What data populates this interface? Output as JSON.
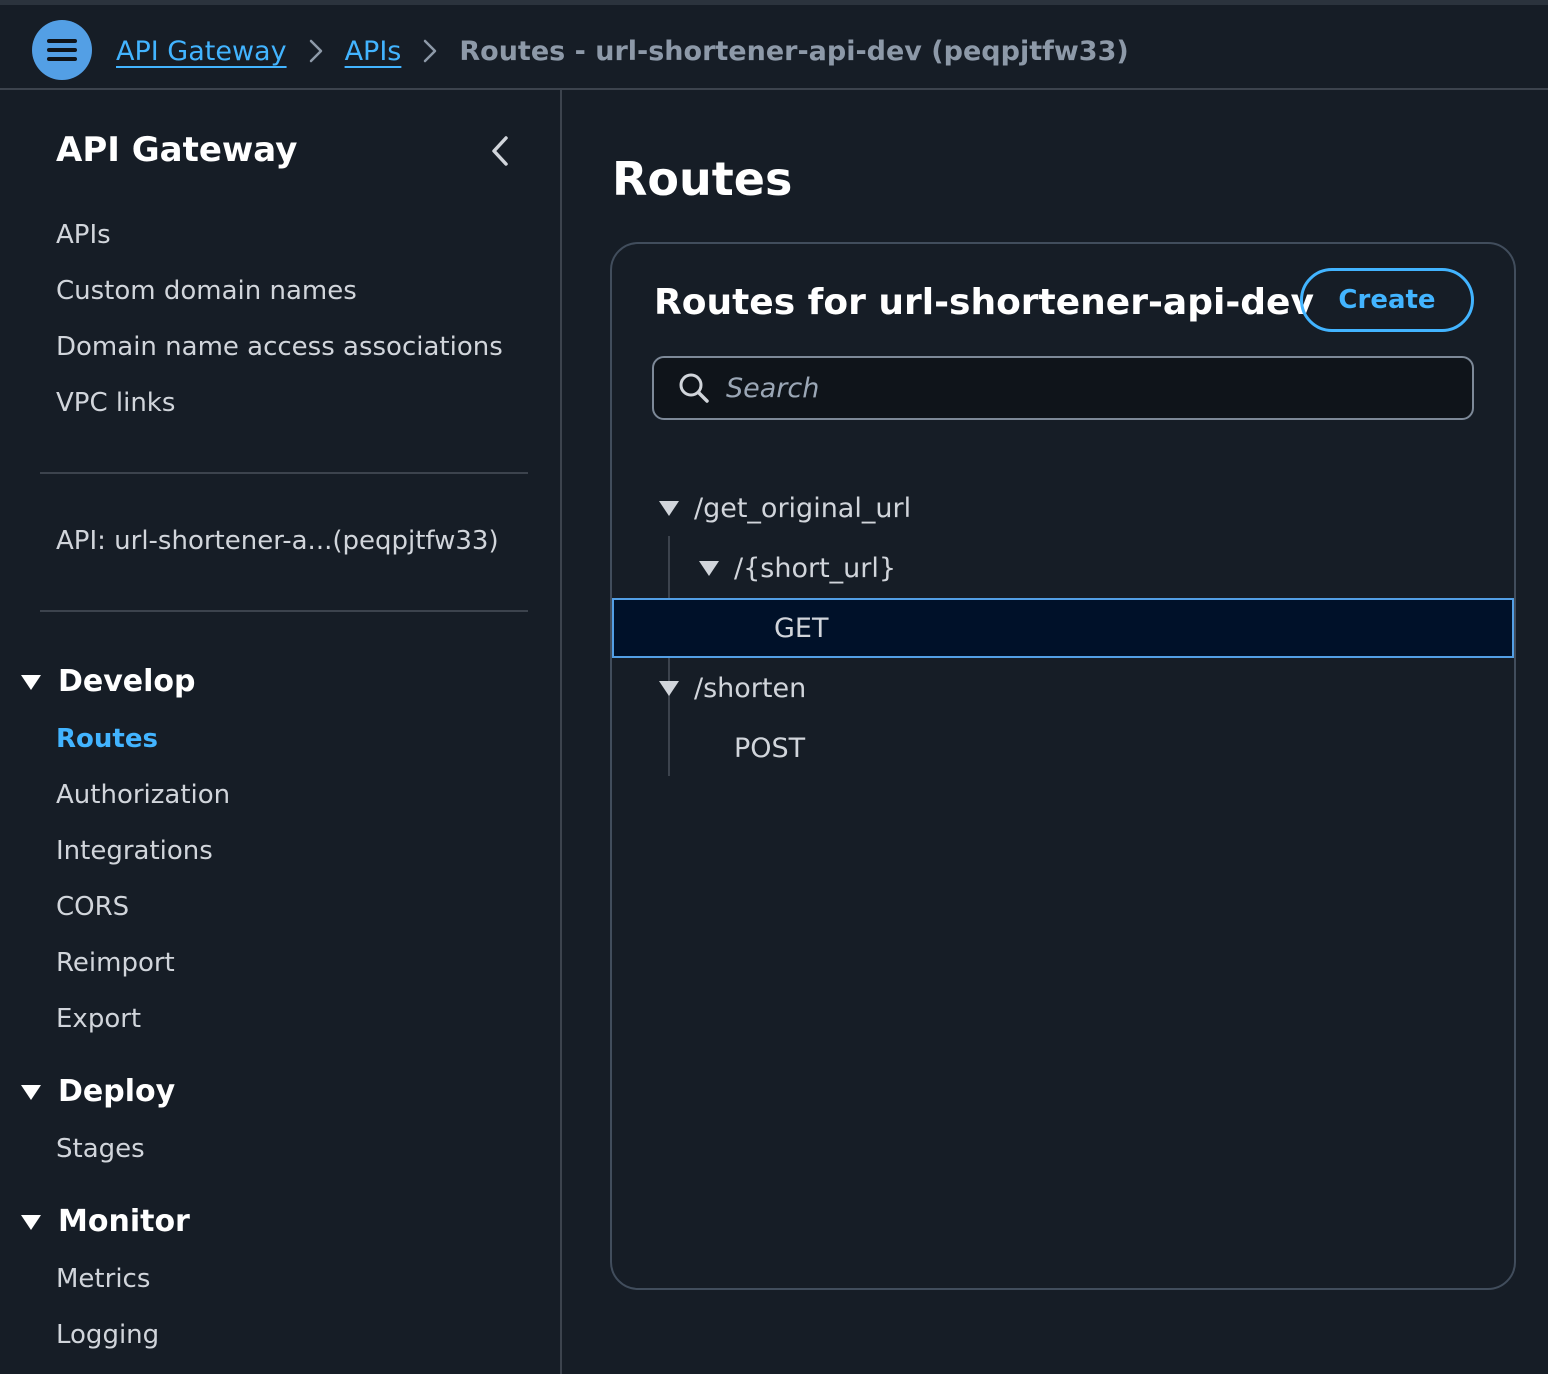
{
  "header": {
    "breadcrumb": {
      "api_gateway": "API Gateway",
      "apis": "APIs",
      "current": "Routes - url-shortener-api-dev (peqpjtfw33)"
    }
  },
  "sidebar": {
    "title": "API Gateway",
    "top_items": [
      "APIs",
      "Custom domain names",
      "Domain name access associations",
      "VPC links"
    ],
    "api_label": "API: url-shortener-a...(peqpjtfw33)",
    "develop": {
      "heading": "Develop",
      "items": [
        "Routes",
        "Authorization",
        "Integrations",
        "CORS",
        "Reimport",
        "Export"
      ]
    },
    "deploy": {
      "heading": "Deploy",
      "items": [
        "Stages"
      ]
    },
    "monitor": {
      "heading": "Monitor",
      "items": [
        "Metrics",
        "Logging"
      ]
    }
  },
  "main": {
    "page_title": "Routes",
    "panel": {
      "title": "Routes for url-shortener-api-dev",
      "create_label": "Create",
      "search_placeholder": "Search",
      "tree": {
        "get_original_url": "/get_original_url",
        "short_url": "/{short_url}",
        "get": "GET",
        "shorten": "/shorten",
        "post": "POST"
      }
    }
  },
  "colors": {
    "accent": "#42b4ff",
    "menu_button": "#539fe5",
    "background": "#161d26",
    "selected_row": "#001129"
  }
}
